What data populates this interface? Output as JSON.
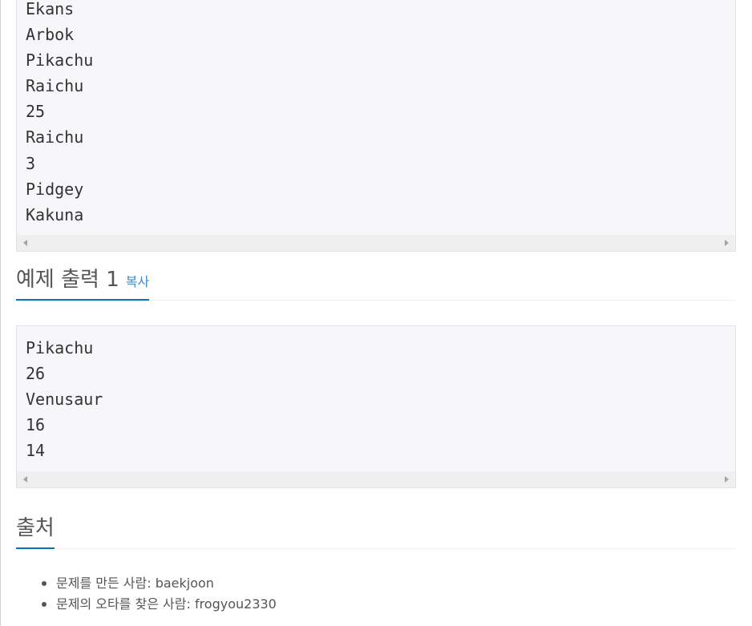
{
  "sample_input": {
    "lines": [
      "Ekans",
      "Arbok",
      "Pikachu",
      "Raichu",
      "25",
      "Raichu",
      "3",
      "Pidgey",
      "Kakuna"
    ]
  },
  "sample_output": {
    "title": "예제 출력 1",
    "copy_label": "복사",
    "lines": [
      "Pikachu",
      "26",
      "Venusaur",
      "16",
      "14"
    ]
  },
  "source": {
    "title": "출처",
    "items": [
      {
        "label": "문제를 만든 사람: ",
        "value": "baekjoon"
      },
      {
        "label": "문제의 오타를 찾은 사람: ",
        "value": "frogyou2330"
      }
    ]
  }
}
